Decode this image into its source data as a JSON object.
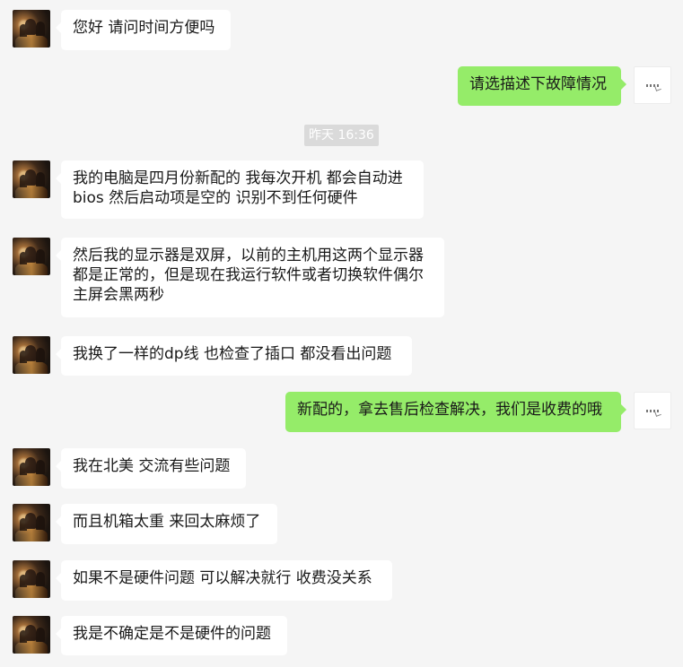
{
  "colors": {
    "background": "#f5f5f5",
    "incoming_bubble": "#ffffff",
    "outgoing_bubble": "#95ec69",
    "timestamp_bg": "#dadada",
    "timestamp_text": "#ffffff"
  },
  "messages": [
    {
      "text": "您好 请问时间方便吗"
    },
    {
      "text": "请选描述下故障情况"
    },
    {
      "text": "我的电脑是四月份新配的 我每次开机 都会自动进\nbios 然后启动项是空的 识别不到任何硬件"
    },
    {
      "text": "然后我的显示器是双屏，以前的主机用这两个显示器\n都是正常的，但是现在我运行软件或者切换软件偶尔\n主屏会黑两秒"
    },
    {
      "text": "我换了一样的dp线 也检查了插口 都没看出问题"
    },
    {
      "text": "新配的，拿去售后检查解决，我们是收费的哦"
    },
    {
      "text": "我在北美 交流有些问题"
    },
    {
      "text": "而且机箱太重 来回太麻烦了"
    },
    {
      "text": "如果不是硬件问题 可以解决就行 收费没关系"
    },
    {
      "text": "我是不确定是不是硬件的问题"
    }
  ],
  "timestamp": {
    "text": "昨天 16:36"
  }
}
